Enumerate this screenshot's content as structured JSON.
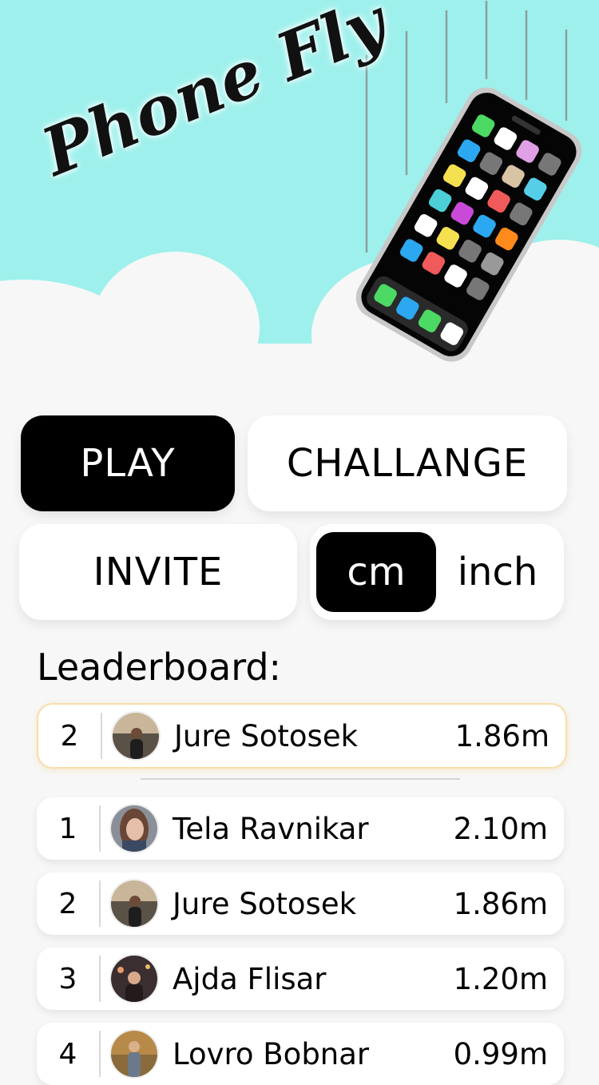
{
  "app": {
    "title": "Phone Fly",
    "colors": {
      "sky": "#9ef0ec",
      "cloud": "#f7f7f7",
      "dark": "#000000",
      "highlight_border": "#f7dfa9"
    }
  },
  "actions": {
    "play_label": "PLAY",
    "challenge_label": "CHALLANGE",
    "invite_label": "INVITE"
  },
  "units": {
    "options": [
      "cm",
      "inch"
    ],
    "selected": "cm"
  },
  "leaderboard": {
    "title": "Leaderboard:",
    "current_user": {
      "rank": "2",
      "name": "Jure Sotosek",
      "distance": "1.86m",
      "avatar": "avatar-jure"
    },
    "entries": [
      {
        "rank": "1",
        "name": "Tela Ravnikar",
        "distance": "2.10m",
        "avatar": "avatar-tela"
      },
      {
        "rank": "2",
        "name": "Jure Sotosek",
        "distance": "1.86m",
        "avatar": "avatar-jure"
      },
      {
        "rank": "3",
        "name": "Ajda Flisar",
        "distance": "1.20m",
        "avatar": "avatar-ajda"
      },
      {
        "rank": "4",
        "name": "Lovro Bobnar",
        "distance": "0.99m",
        "avatar": "avatar-lovro"
      }
    ]
  }
}
